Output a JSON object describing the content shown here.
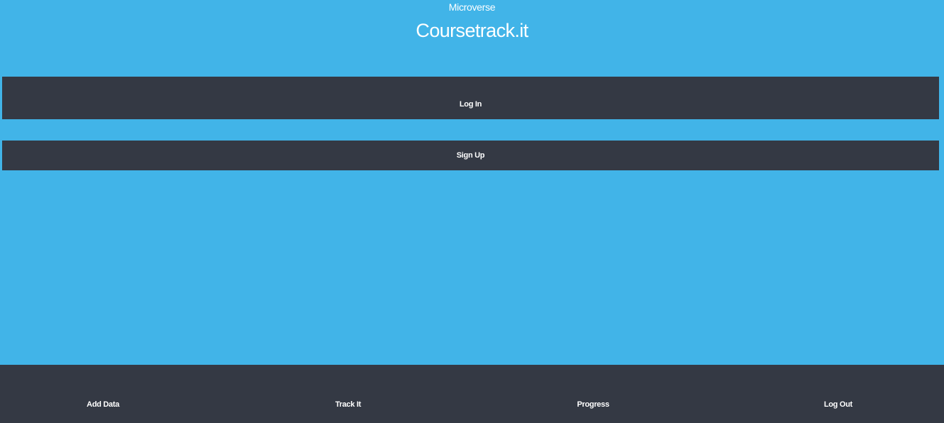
{
  "header": {
    "subtitle": "Microverse",
    "title": "Coursetrack.it"
  },
  "actions": {
    "login_label": "Log In",
    "signup_label": "Sign Up"
  },
  "footer_nav": {
    "items": [
      {
        "label": "Add Data"
      },
      {
        "label": "Track It"
      },
      {
        "label": "Progress"
      },
      {
        "label": "Log Out"
      }
    ]
  },
  "colors": {
    "background": "#41b4e8",
    "dark": "#343944",
    "text": "#ffffff"
  }
}
